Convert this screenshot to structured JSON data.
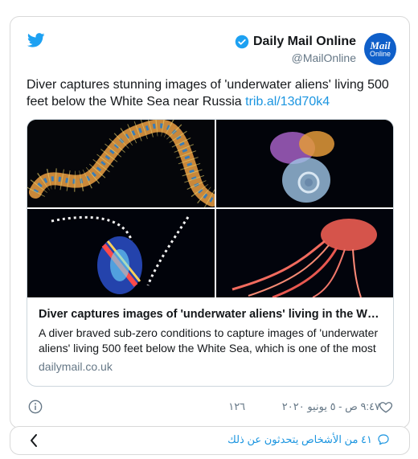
{
  "author": {
    "name": "Daily Mail Online",
    "handle": "@MailOnline",
    "verified": true,
    "avatar_text_1": "Mail",
    "avatar_text_2": "Online",
    "avatar_color": "#0f5fc9"
  },
  "tweet": {
    "text": "Diver captures stunning images of 'underwater aliens' living 500 feet below the White Sea near Russia ",
    "link": "trib.al/13d70k4"
  },
  "media": {
    "images": [
      "bristle-worm",
      "sea-angel-pteropod",
      "comb-jelly",
      "lions-mane-jellyfish"
    ]
  },
  "link_card": {
    "title": "Diver captures images of 'underwater aliens' living in the White Sea ...",
    "description": "A diver braved sub-zero conditions to capture images of 'underwater aliens' living 500 feet below the White Sea, which is one of the most",
    "domain": "dailymail.co.uk"
  },
  "meta": {
    "like_count": "١٢٦",
    "timestamp": "٩:٤٧ ص - ٥ يونيو ٢٠٢٠"
  },
  "footer": {
    "talking_text": "٤١ من الأشخاص يتحدثون عن ذلك"
  },
  "colors": {
    "accent": "#1b95e0",
    "text": "#14171a",
    "muted": "#657786",
    "border": "#ccd6dd"
  }
}
